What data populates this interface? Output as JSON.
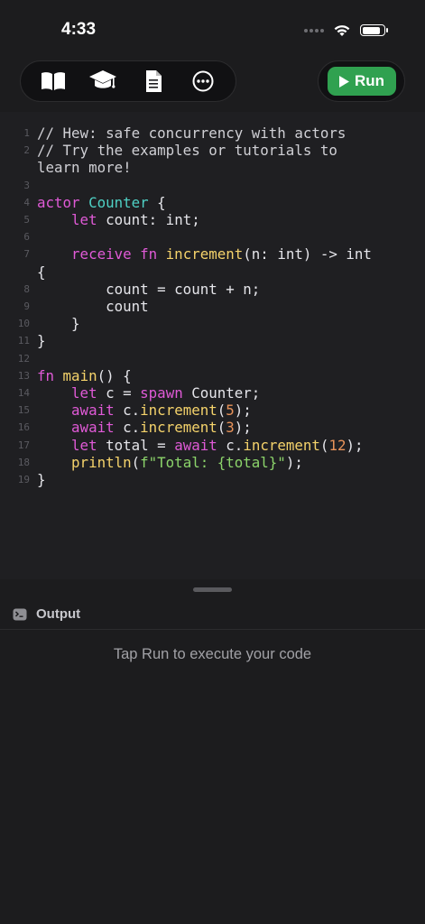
{
  "status_bar": {
    "time": "4:33",
    "battery_level": 0.9
  },
  "toolbar": {
    "icons": [
      "book-icon",
      "graduation-cap-icon",
      "document-icon",
      "more-icon"
    ],
    "run_label": "Run"
  },
  "editor": {
    "lines": [
      {
        "n": "1",
        "tokens": [
          [
            "c",
            "// Hew: safe concurrency with actors"
          ]
        ]
      },
      {
        "n": "2",
        "tokens": [
          [
            "c",
            "// Try the examples or tutorials to"
          ]
        ]
      },
      {
        "n": "",
        "tokens": [
          [
            "c",
            "learn more!"
          ]
        ]
      },
      {
        "n": "3",
        "tokens": []
      },
      {
        "n": "4",
        "tokens": [
          [
            "k",
            "actor"
          ],
          [
            "p",
            " "
          ],
          [
            "t",
            "Counter"
          ],
          [
            "p",
            " {"
          ]
        ]
      },
      {
        "n": "5",
        "tokens": [
          [
            "p",
            "    "
          ],
          [
            "k",
            "let"
          ],
          [
            "p",
            " count: int;"
          ]
        ]
      },
      {
        "n": "6",
        "tokens": []
      },
      {
        "n": "7",
        "tokens": [
          [
            "p",
            "    "
          ],
          [
            "k",
            "receive fn"
          ],
          [
            "p",
            " "
          ],
          [
            "f",
            "increment"
          ],
          [
            "p",
            "(n: int) -> int"
          ]
        ]
      },
      {
        "n": "",
        "tokens": [
          [
            "p",
            "{"
          ]
        ]
      },
      {
        "n": "8",
        "tokens": [
          [
            "p",
            "        count = count + n;"
          ]
        ]
      },
      {
        "n": "9",
        "tokens": [
          [
            "p",
            "        count"
          ]
        ]
      },
      {
        "n": "10",
        "tokens": [
          [
            "p",
            "    }"
          ]
        ]
      },
      {
        "n": "11",
        "tokens": [
          [
            "p",
            "}"
          ]
        ]
      },
      {
        "n": "12",
        "tokens": []
      },
      {
        "n": "13",
        "tokens": [
          [
            "k",
            "fn"
          ],
          [
            "p",
            " "
          ],
          [
            "f",
            "main"
          ],
          [
            "p",
            "() {"
          ]
        ]
      },
      {
        "n": "14",
        "tokens": [
          [
            "p",
            "    "
          ],
          [
            "k",
            "let"
          ],
          [
            "p",
            " c = "
          ],
          [
            "k",
            "spawn"
          ],
          [
            "p",
            " Counter;"
          ]
        ]
      },
      {
        "n": "15",
        "tokens": [
          [
            "p",
            "    "
          ],
          [
            "k",
            "await"
          ],
          [
            "p",
            " c."
          ],
          [
            "f",
            "increment"
          ],
          [
            "p",
            "("
          ],
          [
            "n",
            "5"
          ],
          [
            "p",
            ");"
          ]
        ]
      },
      {
        "n": "16",
        "tokens": [
          [
            "p",
            "    "
          ],
          [
            "k",
            "await"
          ],
          [
            "p",
            " c."
          ],
          [
            "f",
            "increment"
          ],
          [
            "p",
            "("
          ],
          [
            "n",
            "3"
          ],
          [
            "p",
            ");"
          ]
        ]
      },
      {
        "n": "17",
        "tokens": [
          [
            "p",
            "    "
          ],
          [
            "k",
            "let"
          ],
          [
            "p",
            " total = "
          ],
          [
            "k",
            "await"
          ],
          [
            "p",
            " c."
          ],
          [
            "f",
            "increment"
          ],
          [
            "p",
            "("
          ],
          [
            "n",
            "12"
          ],
          [
            "p",
            ");"
          ]
        ]
      },
      {
        "n": "18",
        "tokens": [
          [
            "p",
            "    "
          ],
          [
            "f",
            "println"
          ],
          [
            "p",
            "("
          ],
          [
            "s",
            "f\"Total: {total}\""
          ],
          [
            "p",
            ");"
          ]
        ]
      },
      {
        "n": "19",
        "tokens": [
          [
            "p",
            "}"
          ]
        ]
      }
    ]
  },
  "output": {
    "icon": "terminal-icon",
    "title": "Output",
    "hint": "Tap Run to execute your code"
  },
  "colors": {
    "run_green": "#30a150",
    "keyword": "#e05ad7",
    "type": "#4fd1c5",
    "function": "#f5d36b",
    "number": "#e8935a",
    "string": "#8cd46b"
  }
}
